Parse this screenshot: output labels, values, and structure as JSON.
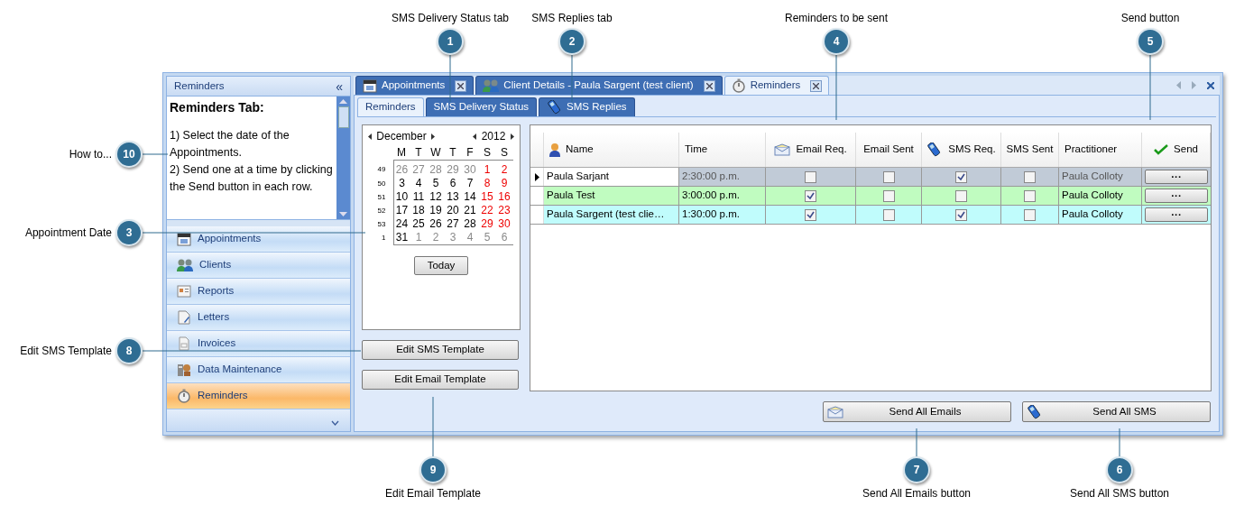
{
  "callouts": [
    {
      "number": "1",
      "label": "SMS Delivery Status tab"
    },
    {
      "number": "2",
      "label": "SMS Replies tab"
    },
    {
      "number": "4",
      "label": "Reminders to be sent"
    },
    {
      "number": "5",
      "label": "Send button"
    },
    {
      "number": "10",
      "label": "How to..."
    },
    {
      "number": "3",
      "label": "Appointment Date"
    },
    {
      "number": "8",
      "label": "Edit SMS Template"
    },
    {
      "number": "9",
      "label": "Edit Email Template"
    },
    {
      "number": "7",
      "label": "Send All Emails button"
    },
    {
      "number": "6",
      "label": "Send All SMS button"
    }
  ],
  "sidebar": {
    "title": "Reminders",
    "collapse": "«",
    "help_title": "Reminders Tab:",
    "help_lines": [
      "1)  Select the date of the Appointments.",
      "2)  Send one at a time by clicking the Send button in each row."
    ],
    "items": [
      {
        "label": "Appointments",
        "selected": false
      },
      {
        "label": "Clients",
        "selected": false
      },
      {
        "label": "Reports",
        "selected": false
      },
      {
        "label": "Letters",
        "selected": false
      },
      {
        "label": "Invoices",
        "selected": false
      },
      {
        "label": "Data Maintenance",
        "selected": false
      },
      {
        "label": "Reminders",
        "selected": true
      }
    ]
  },
  "tabs": [
    {
      "label": "Appointments",
      "selected": false
    },
    {
      "label": "Client Details - Paula Sargent (test client)",
      "selected": false
    },
    {
      "label": "Reminders",
      "selected": true
    }
  ],
  "subtabs": [
    {
      "label": "Reminders",
      "selected": true
    },
    {
      "label": "SMS Delivery Status",
      "selected": false
    },
    {
      "label": "SMS Replies",
      "selected": false
    }
  ],
  "calendar": {
    "month": "December",
    "year": "2012",
    "weekdays": [
      "M",
      "T",
      "W",
      "T",
      "F",
      "S",
      "S"
    ],
    "weeks": [
      {
        "number": "49",
        "days": [
          {
            "text": "26",
            "kind": "other"
          },
          {
            "text": "27",
            "kind": "other"
          },
          {
            "text": "28",
            "kind": "other"
          },
          {
            "text": "29",
            "kind": "other"
          },
          {
            "text": "30",
            "kind": "other"
          },
          {
            "text": "1",
            "kind": "weekend"
          },
          {
            "text": "2",
            "kind": "weekend"
          }
        ]
      },
      {
        "number": "50",
        "days": [
          {
            "text": "3",
            "kind": "normal"
          },
          {
            "text": "4",
            "kind": "normal"
          },
          {
            "text": "5",
            "kind": "normal"
          },
          {
            "text": "6",
            "kind": "normal"
          },
          {
            "text": "7",
            "kind": "normal"
          },
          {
            "text": "8",
            "kind": "weekend"
          },
          {
            "text": "9",
            "kind": "weekend"
          }
        ]
      },
      {
        "number": "51",
        "days": [
          {
            "text": "10",
            "kind": "normal"
          },
          {
            "text": "11",
            "kind": "normal"
          },
          {
            "text": "12",
            "kind": "normal"
          },
          {
            "text": "13",
            "kind": "normal"
          },
          {
            "text": "14",
            "kind": "normal"
          },
          {
            "text": "15",
            "kind": "weekend"
          },
          {
            "text": "16",
            "kind": "weekend"
          }
        ]
      },
      {
        "number": "52",
        "days": [
          {
            "text": "17",
            "kind": "normal"
          },
          {
            "text": "18",
            "kind": "normal"
          },
          {
            "text": "19",
            "kind": "normal"
          },
          {
            "text": "20",
            "kind": "normal"
          },
          {
            "text": "21",
            "kind": "normal"
          },
          {
            "text": "22",
            "kind": "weekend"
          },
          {
            "text": "23",
            "kind": "weekend"
          }
        ]
      },
      {
        "number": "53",
        "days": [
          {
            "text": "24",
            "kind": "normal"
          },
          {
            "text": "25",
            "kind": "normal"
          },
          {
            "text": "26",
            "kind": "normal"
          },
          {
            "text": "27",
            "kind": "normal"
          },
          {
            "text": "28",
            "kind": "normal"
          },
          {
            "text": "29",
            "kind": "weekend"
          },
          {
            "text": "30",
            "kind": "weekend"
          }
        ]
      },
      {
        "number": "1",
        "days": [
          {
            "text": "31",
            "kind": "normal"
          },
          {
            "text": "1",
            "kind": "other"
          },
          {
            "text": "2",
            "kind": "other"
          },
          {
            "text": "3",
            "kind": "other"
          },
          {
            "text": "4",
            "kind": "other"
          },
          {
            "text": "5",
            "kind": "other"
          },
          {
            "text": "6",
            "kind": "other"
          }
        ]
      }
    ],
    "today_button": "Today"
  },
  "template_buttons": [
    "Edit SMS Template",
    "Edit Email Template"
  ],
  "table": {
    "columns": [
      "Name",
      "Time",
      "Email Req.",
      "Email Sent",
      "SMS Req.",
      "SMS Sent",
      "Practitioner",
      "Send"
    ],
    "rows": [
      {
        "selected": true,
        "color": "#c1cbd7",
        "name": "Paula Sarjant",
        "time": "2:30:00 p.m.",
        "email_req": false,
        "email_sent": false,
        "sms_req": true,
        "sms_sent": false,
        "practitioner": "Paula Colloty",
        "send": "···"
      },
      {
        "selected": false,
        "color": "#c0fcc0",
        "name": "Paula Test",
        "time": "3:00:00 p.m.",
        "email_req": true,
        "email_sent": false,
        "sms_req": false,
        "sms_sent": false,
        "practitioner": "Paula Colloty",
        "send": "···"
      },
      {
        "selected": false,
        "color": "#c0fcfc",
        "name": "Paula Sargent (test clie…",
        "time": "1:30:00 p.m.",
        "email_req": true,
        "email_sent": false,
        "sms_req": true,
        "sms_sent": false,
        "practitioner": "Paula Colloty",
        "send": "···"
      }
    ]
  },
  "send_buttons": [
    "Send All Emails",
    "Send All SMS"
  ]
}
